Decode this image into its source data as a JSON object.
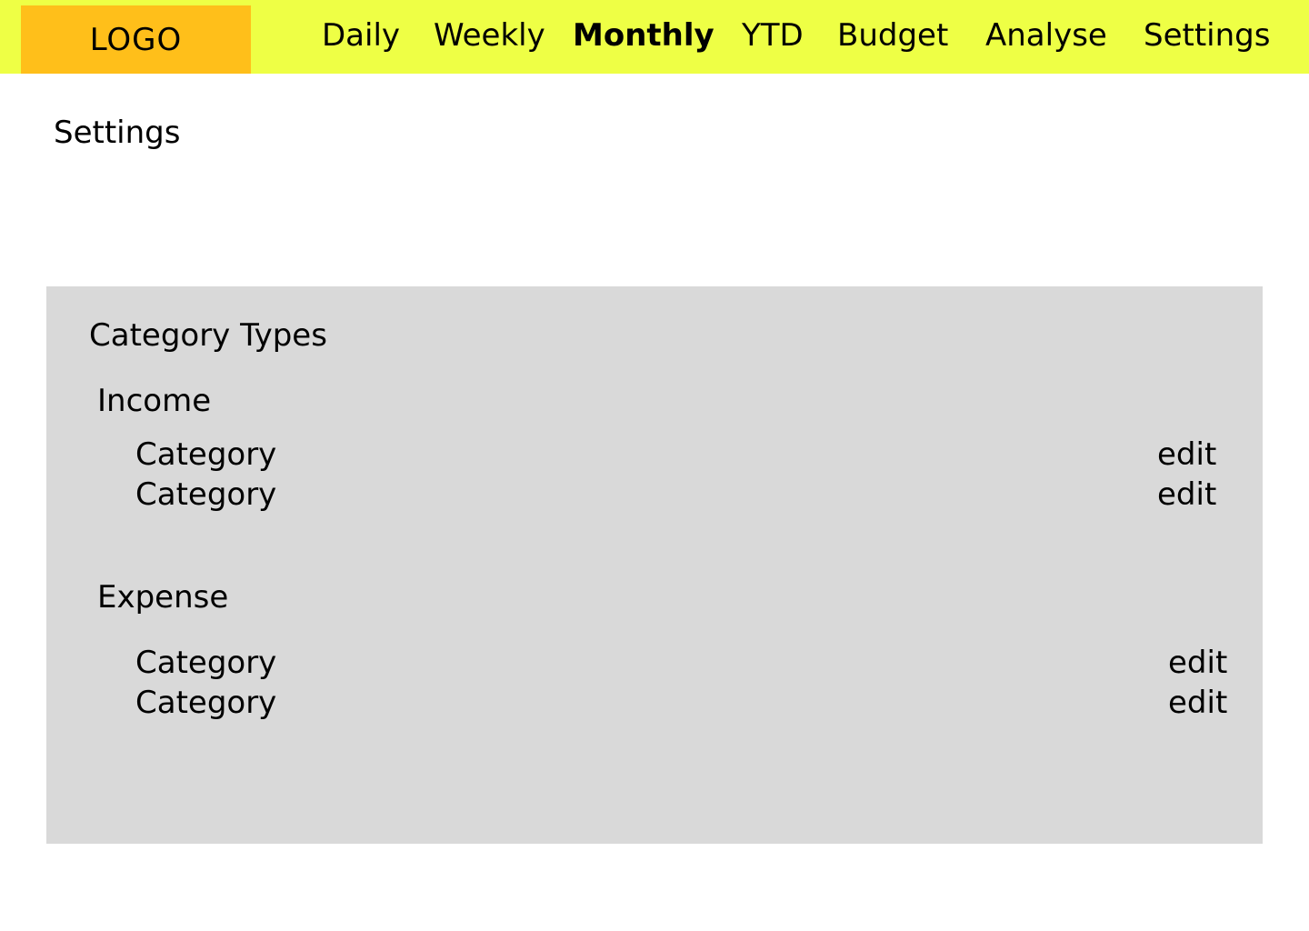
{
  "header": {
    "logo": "LOGO",
    "nav": [
      {
        "label": "Daily"
      },
      {
        "label": "Weekly"
      },
      {
        "label": "Monthly",
        "active": true
      },
      {
        "label": "YTD"
      },
      {
        "label": "Budget"
      },
      {
        "label": "Analyse"
      },
      {
        "label": "Settings"
      }
    ]
  },
  "page": {
    "title": "Settings"
  },
  "category_types": {
    "title": "Category Types",
    "income": {
      "title": "Income",
      "items": [
        {
          "label": "Category",
          "action": "edit"
        },
        {
          "label": "Category",
          "action": "edit"
        }
      ]
    },
    "expense": {
      "title": "Expense",
      "items": [
        {
          "label": "Category",
          "action": "edit"
        },
        {
          "label": "Category",
          "action": "edit"
        }
      ]
    }
  },
  "colors": {
    "header_bg": "#eeff45",
    "logo_bg": "#ffbf1a",
    "panel_bg": "#d9d9d9"
  }
}
